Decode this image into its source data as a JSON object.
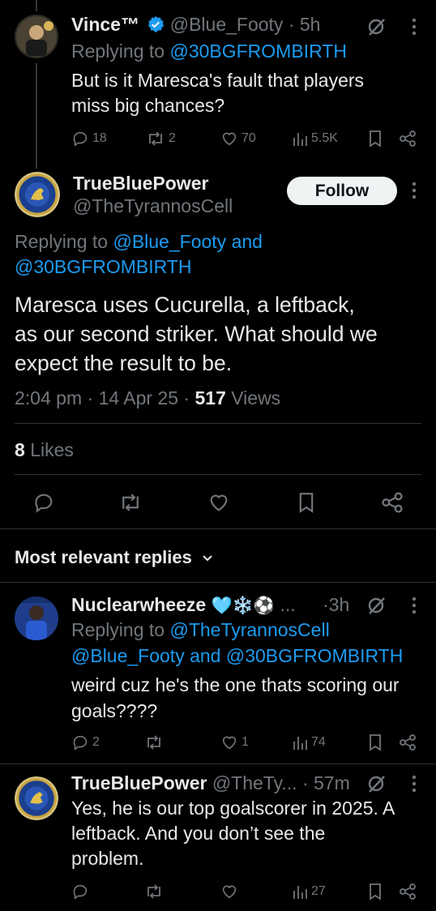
{
  "tweet1": {
    "name": "Vince™",
    "handle": "@Blue_Footy",
    "sep": "·",
    "time": "5h",
    "replying_prefix": "Replying to",
    "replying_to": "@30BGFROMBIRTH",
    "text_line1": "But is it Maresca's fault that players",
    "text_line2": "miss big chances?",
    "replies": "18",
    "reposts": "2",
    "likes": "70",
    "views": "5.5K"
  },
  "main": {
    "name": "TrueBluePower",
    "handle": "@TheTyrannosCell",
    "follow_label": "Follow",
    "replying_prefix": "Replying to",
    "replying_to_1": "@Blue_Footy",
    "and_word": "and",
    "replying_to_2": "@30BGFROMBIRTH",
    "text_line1": "Maresca uses Cucurella, a leftback,",
    "text_line2": "as our second striker. What should we",
    "text_line3": "expect the result to be.",
    "time": "2:04 pm",
    "date": "14 Apr 25",
    "views_count": "517",
    "views_label": "Views",
    "likes_count": "8",
    "likes_label": "Likes"
  },
  "replies_header": {
    "label": "Most relevant replies"
  },
  "reply1": {
    "name": "Nuclearwheeze",
    "emojis": "🩵❄️⚽",
    "ellipsis": "...",
    "time": "·3h",
    "replying_prefix": "Replying to",
    "replying_to_1": "@TheTyrannosCell",
    "replying_to_2": "@Blue_Footy",
    "and_word": "and",
    "replying_to_3": "@30BGFROMBIRTH",
    "text_line1": "weird cuz he's the one thats scoring our",
    "text_line2": "goals????",
    "replies": "2",
    "reposts": "",
    "likes": "1",
    "views": "74"
  },
  "reply2": {
    "name": "TrueBluePower",
    "handle": "@TheTy...",
    "time": "· 57m",
    "text_line1": "Yes, he is our top goalscorer in 2025. A",
    "text_line2": "leftback. And you don’t see the",
    "text_line3": "problem.",
    "views": "27"
  },
  "colors": {
    "background": "#000000",
    "text": "#e7e9ea",
    "muted": "#71767b",
    "link": "#1d9bf0",
    "verified": "#1d9bf0",
    "divider": "#2f3336"
  }
}
